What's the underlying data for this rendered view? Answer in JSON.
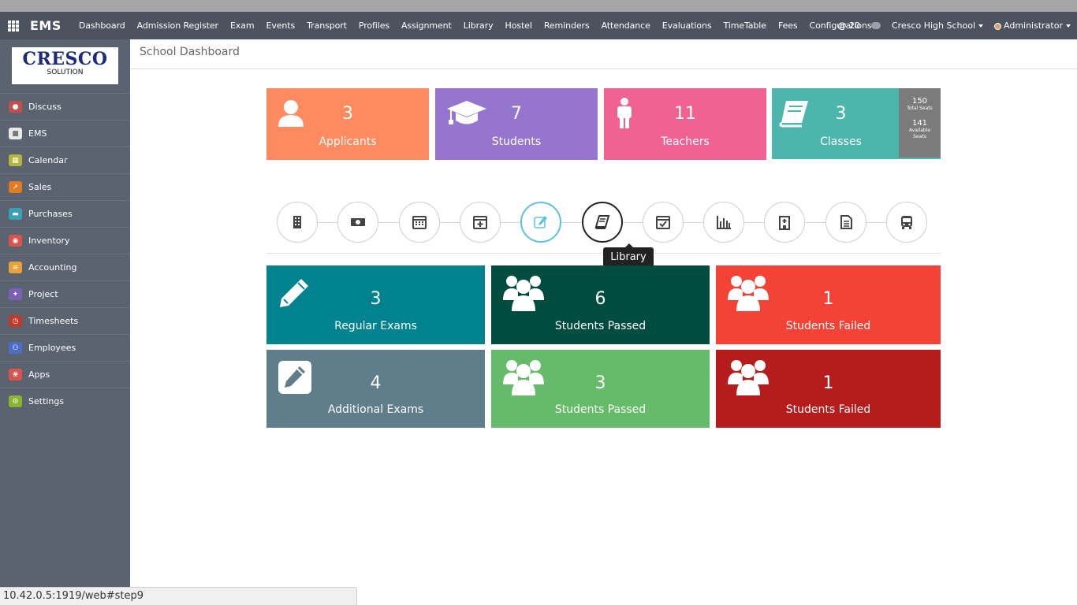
{
  "topbar": {
    "brand": "EMS",
    "menu": [
      "Dashboard",
      "Admission Register",
      "Exam",
      "Events",
      "Transport",
      "Profiles",
      "Assignment",
      "Library",
      "Hostel",
      "Reminders",
      "Attendance",
      "Evaluations",
      "TimeTable",
      "Fees",
      "Configurations"
    ],
    "notifications_count": "20",
    "company": "Cresco High School",
    "user": "Administrator"
  },
  "sidebar": {
    "logo_main": "CRESCO",
    "logo_sub": "SOLUTION",
    "items": [
      {
        "label": "Discuss",
        "icon": "discuss-icon",
        "color": "#c0504d"
      },
      {
        "label": "EMS",
        "icon": "ems-icon",
        "color": "#e8e8e8"
      },
      {
        "label": "Calendar",
        "icon": "calendar-icon",
        "color": "#b5b53a"
      },
      {
        "label": "Sales",
        "icon": "sales-icon",
        "color": "#e07b22"
      },
      {
        "label": "Purchases",
        "icon": "purchases-icon",
        "color": "#3aa0b8"
      },
      {
        "label": "Inventory",
        "icon": "inventory-icon",
        "color": "#d9534f"
      },
      {
        "label": "Accounting",
        "icon": "accounting-icon",
        "color": "#e8a23a"
      },
      {
        "label": "Project",
        "icon": "project-icon",
        "color": "#7a5fb5"
      },
      {
        "label": "Timesheets",
        "icon": "timesheets-icon",
        "color": "#c0392b"
      },
      {
        "label": "Employees",
        "icon": "employees-icon",
        "color": "#4b6fc9"
      },
      {
        "label": "Apps",
        "icon": "apps-puzzle-icon",
        "color": "#d9534f"
      },
      {
        "label": "Settings",
        "icon": "settings-icon",
        "color": "#8ab62e"
      }
    ]
  },
  "breadcrumb": "School Dashboard",
  "top_tiles": [
    {
      "num": "3",
      "label": "Applicants",
      "color": "#ff8a5f",
      "icon": "user-icon"
    },
    {
      "num": "7",
      "label": "Students",
      "color": "#9575cd",
      "icon": "graduation-cap-icon"
    },
    {
      "num": "11",
      "label": "Teachers",
      "color": "#f06292",
      "icon": "person-icon"
    },
    {
      "num": "3",
      "label": "Classes",
      "color": "#4db6ac",
      "icon": "book-icon"
    }
  ],
  "seats": {
    "total": "150",
    "total_label": "Total Seats",
    "available": "141",
    "available_label": "Available Seats"
  },
  "nav_icons": [
    "building-icon",
    "money-icon",
    "calendar-grid-icon",
    "calendar-plus-icon",
    "edit-icon",
    "library-book-icon",
    "calendar-check-icon",
    "bar-chart-icon",
    "hospital-icon",
    "document-icon",
    "bus-icon"
  ],
  "tooltip": "Library",
  "exam_tiles": [
    {
      "num": "3",
      "label": "Regular Exams",
      "color": "#00838f",
      "icon": "pencil-icon"
    },
    {
      "num": "6",
      "label": "Students Passed",
      "color": "#004d40",
      "icon": "users-group-icon"
    },
    {
      "num": "1",
      "label": "Students Failed",
      "color": "#f44336",
      "icon": "users-group-icon"
    },
    {
      "num": "4",
      "label": "Additional Exams",
      "color": "#607d8b",
      "icon": "edit-square-icon"
    },
    {
      "num": "3",
      "label": "Students Passed",
      "color": "#66bb6a",
      "icon": "users-group-icon"
    },
    {
      "num": "1",
      "label": "Students Failed",
      "color": "#b71c1c",
      "icon": "users-group-icon"
    }
  ],
  "statusbar": "10.42.0.5:1919/web#step9"
}
